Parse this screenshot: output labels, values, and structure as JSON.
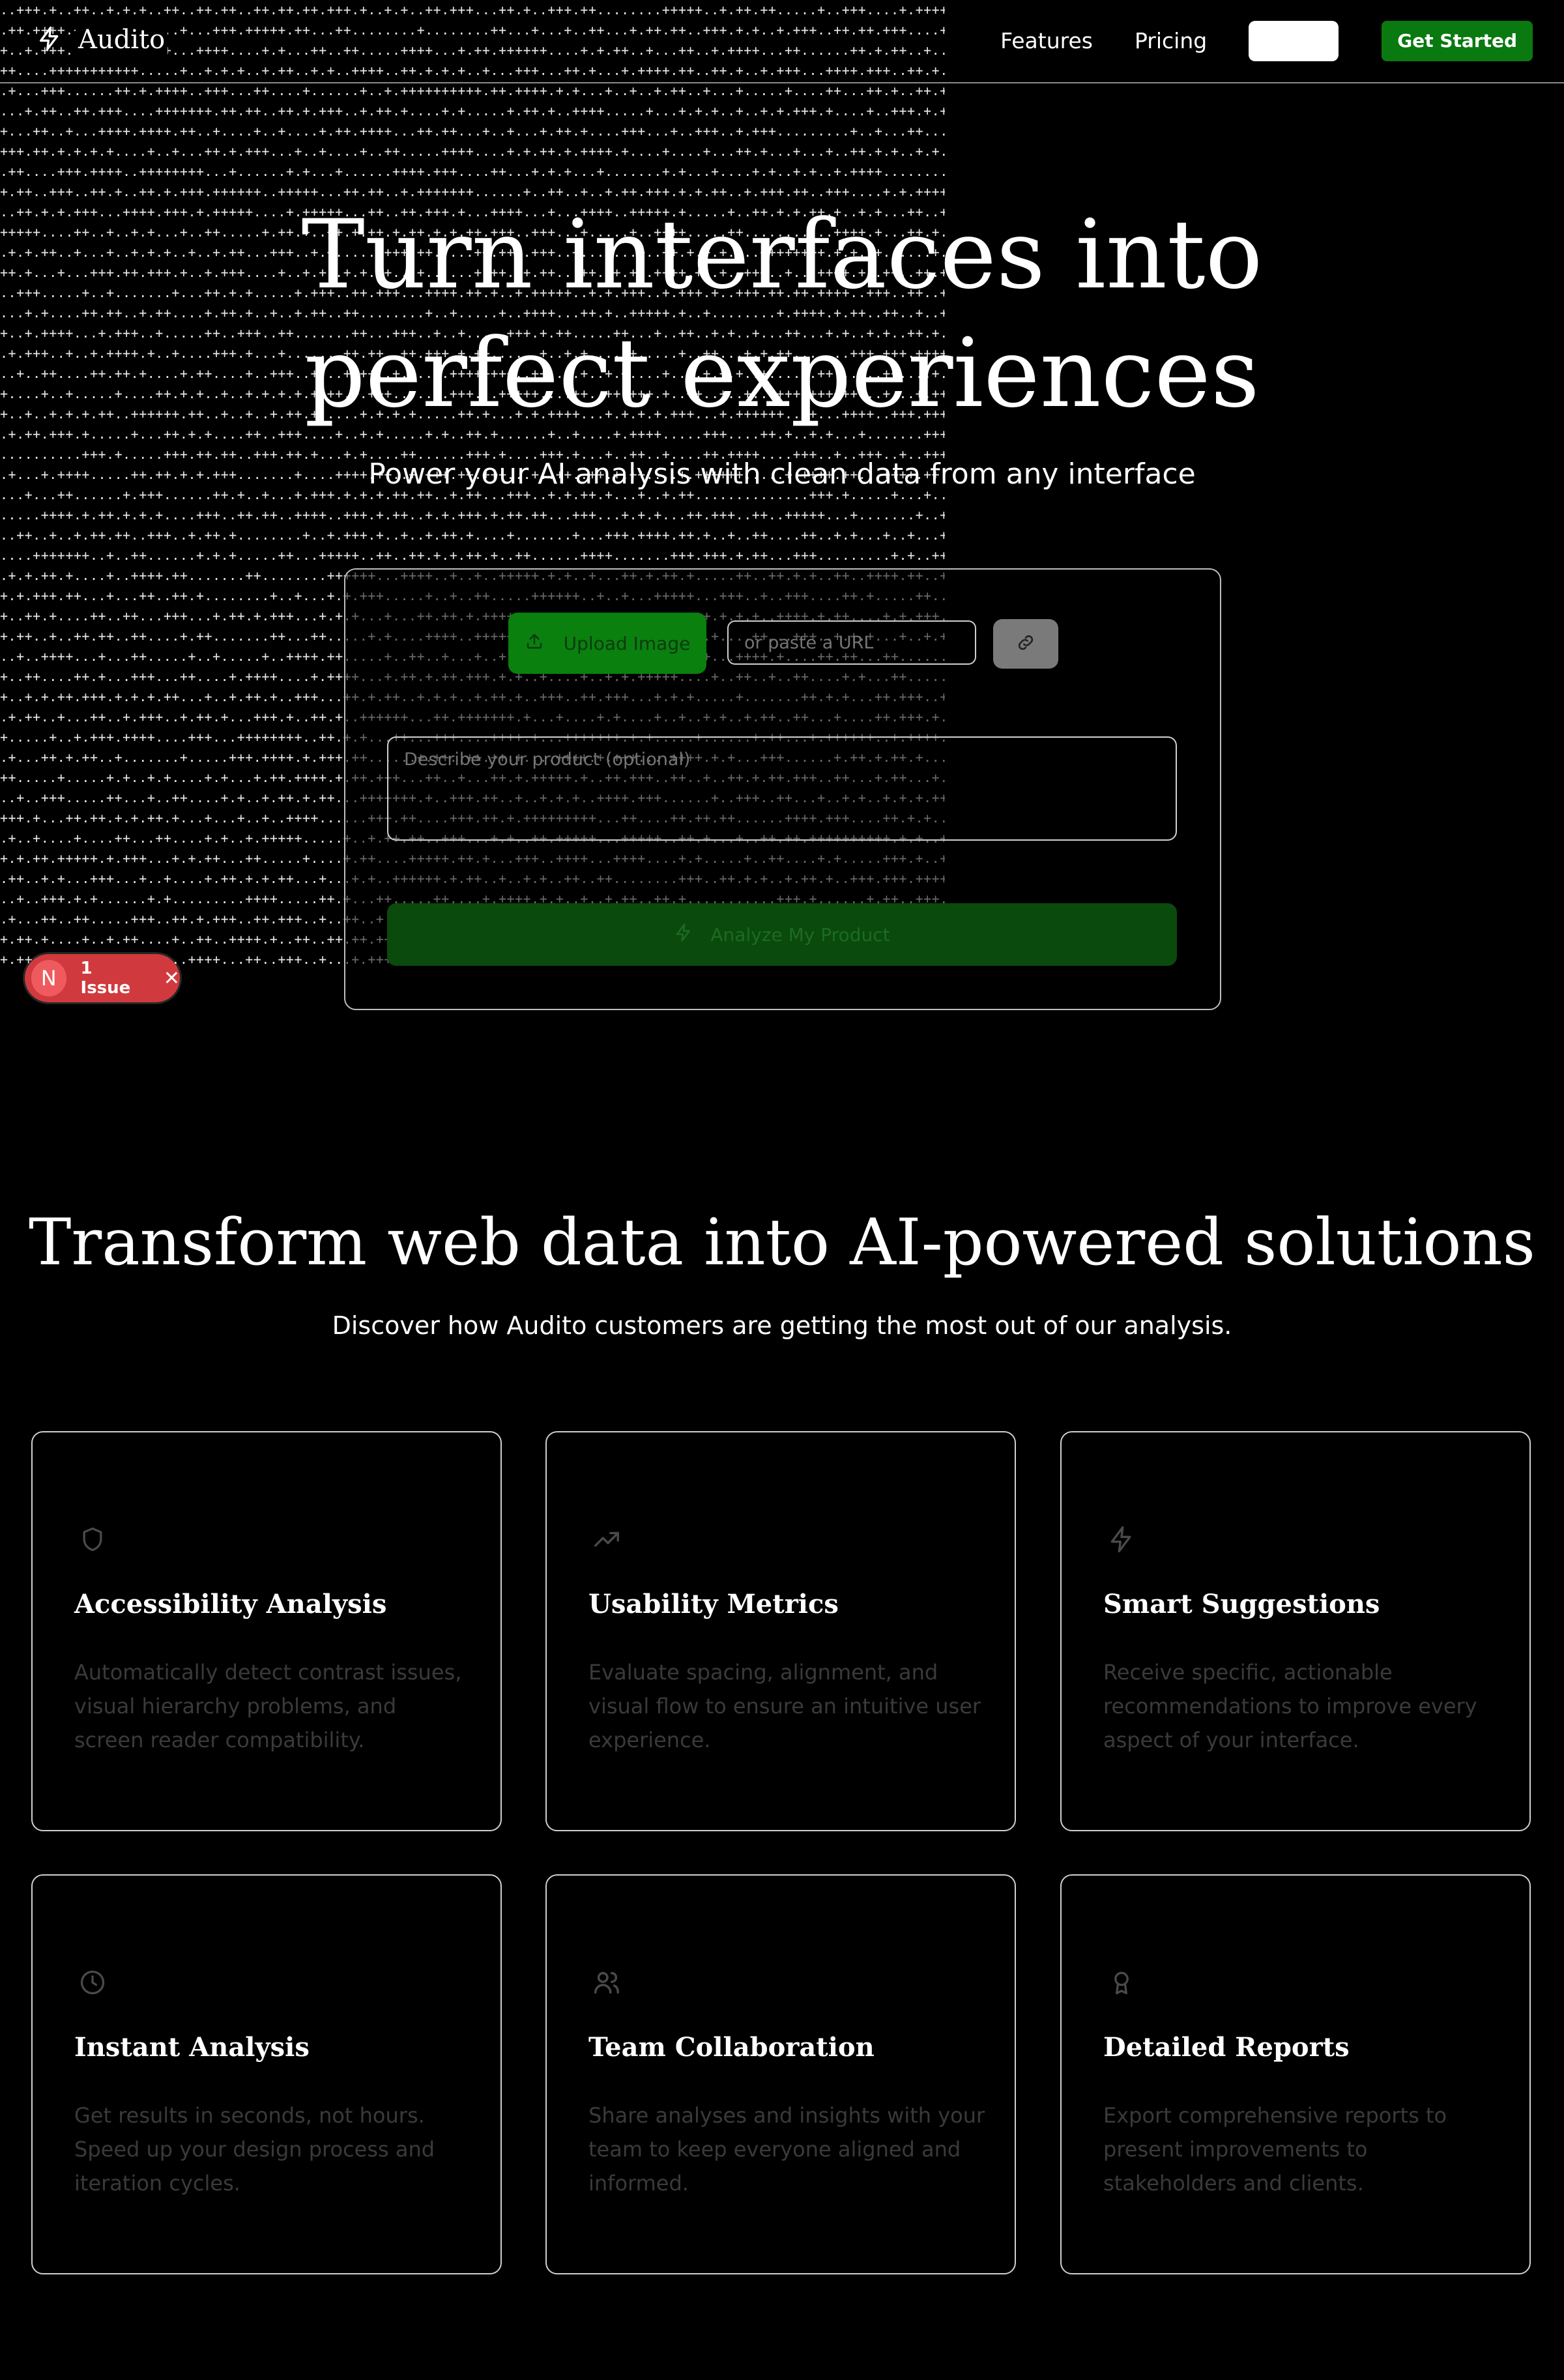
{
  "brand": {
    "name": "Audito"
  },
  "nav": {
    "links": [
      "Features",
      "Pricing"
    ],
    "login_label": "",
    "cta_label": "Get Started"
  },
  "hero": {
    "title_line1": "Turn interfaces into",
    "title_line2": "perfect experiences",
    "subtitle": "Power your AI analysis with clean data from any interface"
  },
  "analyzer": {
    "upload_label": "Upload Image",
    "url_placeholder": "or paste a URL",
    "description_placeholder": "Describe your product (optional)",
    "analyze_label": "Analyze My Product"
  },
  "issues": {
    "count_label": "1 Issue",
    "badge_letter": "N"
  },
  "features_section": {
    "title": "Transform web data into AI-powered solutions",
    "subtitle": "Discover how Audito customers are getting the most out of our analysis.",
    "cards": [
      {
        "icon": "shield-icon",
        "title": "Accessibility Analysis",
        "description": "Automatically detect contrast issues, visual hierarchy problems, and screen reader compatibility."
      },
      {
        "icon": "trending-up-icon",
        "title": "Usability Metrics",
        "description": "Evaluate spacing, alignment, and visual flow to ensure an intuitive user experience."
      },
      {
        "icon": "lightning-icon",
        "title": "Smart Suggestions",
        "description": "Receive specific, actionable recommendations to improve every aspect of your interface."
      },
      {
        "icon": "clock-icon",
        "title": "Instant Analysis",
        "description": "Get results in seconds, not hours. Speed up your design process and iteration cycles."
      },
      {
        "icon": "users-icon",
        "title": "Team Collaboration",
        "description": "Share analyses and insights with your team to keep everyone aligned and informed."
      },
      {
        "icon": "award-icon",
        "title": "Detailed Reports",
        "description": "Export comprehensive reports to present improvements to stakeholders and clients."
      }
    ]
  },
  "colors": {
    "background": "#000000",
    "accent_green": "#0a7a10",
    "issue_red": "#d03a3e",
    "muted_text": "#3a3a3a"
  }
}
